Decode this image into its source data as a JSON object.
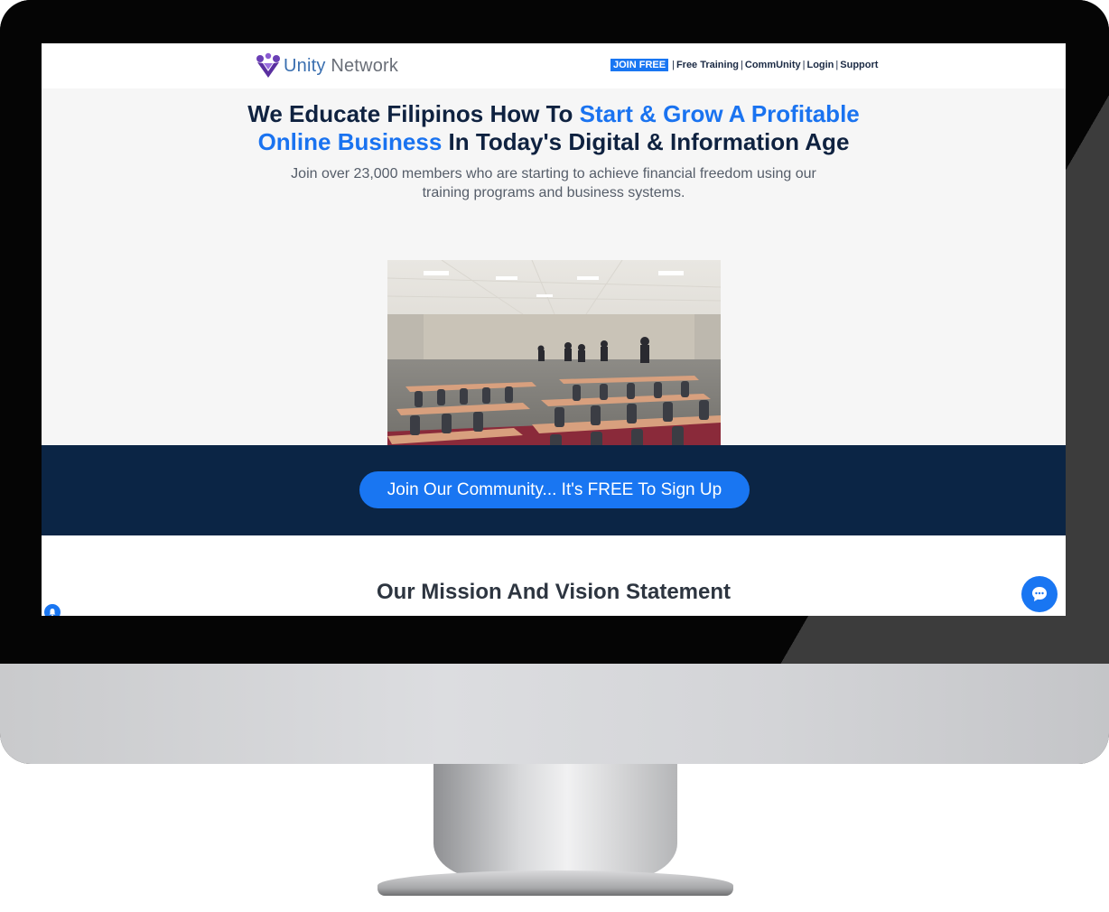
{
  "logo": {
    "name_part1": "Unity",
    "name_part2": " Network",
    "icon": "unity-network-logo-icon"
  },
  "nav": {
    "join": "JOIN FREE",
    "separator": "|",
    "items": [
      "Free Training",
      "CommUnity",
      "Login",
      "Support"
    ]
  },
  "hero": {
    "headline_part1": "We Educate Filipinos How To ",
    "headline_highlight1": "Start & Grow A Profitable",
    "headline_highlight2": "Online Business",
    "headline_part2": " In Today's Digital & Information Age",
    "subtext": "Join over 23,000 members who are starting to achieve financial freedom using our training programs and business systems."
  },
  "cta": {
    "label": "Join Our Community... It's FREE To Sign Up"
  },
  "mission": {
    "title": "Our Mission And Vision Statement"
  },
  "widgets": {
    "chat_icon": "chat-bubble-icon",
    "bell_icon": "bell-icon"
  },
  "colors": {
    "accent": "#1976f2",
    "navy": "#0b2545",
    "heading": "#0f2240"
  }
}
